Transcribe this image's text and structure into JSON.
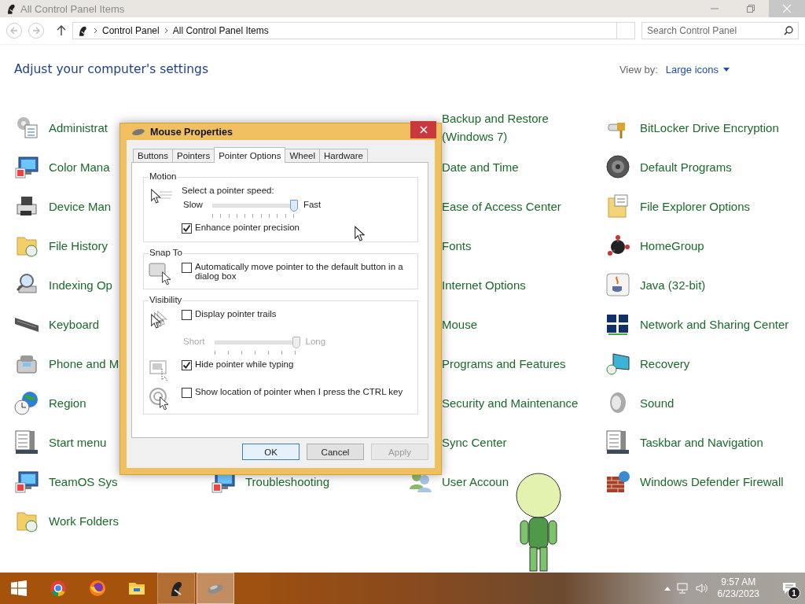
{
  "window": {
    "title": "All Control Panel Items"
  },
  "address_bar": {
    "path": [
      "Control Panel",
      "All Control Panel Items"
    ]
  },
  "search": {
    "placeholder": "Search Control Panel"
  },
  "heading": "Adjust your computer's settings",
  "view_by": {
    "label": "View by:",
    "value": "Large icons"
  },
  "columns": [
    [
      {
        "label": "Administrat",
        "kind": "shown"
      },
      {
        "label": "Color Mana",
        "kind": "shown"
      },
      {
        "label": "Device Man",
        "kind": "shown"
      },
      {
        "label": "File History",
        "kind": "shown"
      },
      {
        "label": "Indexing Op",
        "kind": "shown"
      },
      {
        "label": "Keyboard",
        "kind": "shown"
      },
      {
        "label": "Phone and M",
        "kind": "shown"
      },
      {
        "label": "Region",
        "kind": "shown"
      },
      {
        "label": "Start menu",
        "kind": "shown"
      },
      {
        "label": "TeamOS Sys",
        "kind": "shown"
      },
      {
        "label": "Work Folders",
        "kind": "shown"
      }
    ],
    [
      {
        "label": "Troubleshooting",
        "kind": "shown"
      }
    ],
    [
      {
        "label": "Backup and Restore (Windows 7)",
        "kind": "covered"
      },
      {
        "label": "Date and Time",
        "kind": "covered"
      },
      {
        "label": "Ease of Access Center",
        "kind": "covered"
      },
      {
        "label": "Fonts",
        "kind": "covered"
      },
      {
        "label": "Internet Options",
        "kind": "covered"
      },
      {
        "label": "Mouse",
        "kind": "covered"
      },
      {
        "label": "Programs and Features",
        "kind": "covered"
      },
      {
        "label": "Security and Maintenance",
        "kind": "covered"
      },
      {
        "label": "Sync Center",
        "kind": "covered"
      },
      {
        "label": "User Accoun",
        "kind": "shown"
      }
    ],
    [
      {
        "label": "BitLocker Drive Encryption",
        "kind": "shown"
      },
      {
        "label": "Default Programs",
        "kind": "shown"
      },
      {
        "label": "File Explorer Options",
        "kind": "shown"
      },
      {
        "label": "HomeGroup",
        "kind": "shown"
      },
      {
        "label": "Java (32-bit)",
        "kind": "shown"
      },
      {
        "label": "Network and Sharing Center",
        "kind": "shown"
      },
      {
        "label": "Recovery",
        "kind": "shown"
      },
      {
        "label": "Sound",
        "kind": "shown"
      },
      {
        "label": "Taskbar and Navigation",
        "kind": "shown"
      },
      {
        "label": "Windows Defender Firewall",
        "kind": "shown"
      }
    ]
  ],
  "dialog": {
    "title": "Mouse Properties",
    "tabs": [
      {
        "label": "Buttons",
        "selected": false
      },
      {
        "label": "Pointers",
        "selected": false
      },
      {
        "label": "Pointer Options",
        "selected": true
      },
      {
        "label": "Wheel",
        "selected": false
      },
      {
        "label": "Hardware",
        "selected": false
      }
    ],
    "groups": [
      {
        "title": "Motion",
        "rows": [
          {
            "kind": "slider",
            "label": "Select a pointer speed:",
            "min_label": "Slow",
            "max_label": "Fast",
            "level": 1,
            "disabled": false
          },
          {
            "kind": "checkbox",
            "label": "Enhance pointer precision",
            "checked": true
          }
        ]
      },
      {
        "title": "Snap To",
        "rows": [
          {
            "kind": "checkbox",
            "label": "Automatically move pointer to the default button in a dialog box",
            "checked": false
          }
        ]
      },
      {
        "title": "Visibility",
        "rows": [
          {
            "kind": "checkbox",
            "label": "Display pointer trails",
            "checked": false
          },
          {
            "kind": "slider",
            "min_label": "Short",
            "max_label": "Long",
            "level": 1,
            "disabled": true
          },
          {
            "kind": "checkbox",
            "label": "Hide pointer while typing",
            "checked": true
          },
          {
            "kind": "checkbox",
            "label": "Show location of pointer when I press the CTRL key",
            "checked": false
          }
        ]
      }
    ],
    "buttons": [
      {
        "label": "OK",
        "default": true,
        "disabled": false
      },
      {
        "label": "Cancel",
        "default": false,
        "disabled": false
      },
      {
        "label": "Apply",
        "default": false,
        "disabled": true
      }
    ]
  },
  "taskbar": {
    "apps": [
      {
        "running": false,
        "selected": false
      },
      {
        "running": false,
        "selected": false
      },
      {
        "running": false,
        "selected": false
      },
      {
        "running": true,
        "selected": false
      },
      {
        "running": true,
        "selected": true
      }
    ],
    "clock": {
      "time": "9:57 AM",
      "date": "6/23/2023"
    },
    "notifications": {
      "count": "1"
    }
  }
}
